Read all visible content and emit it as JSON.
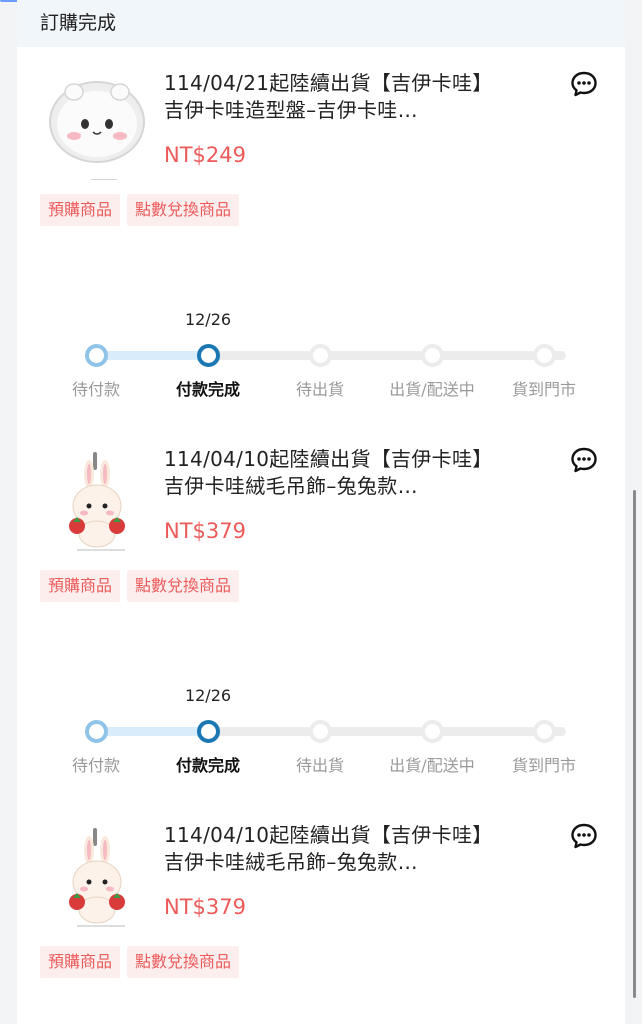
{
  "header": {
    "title": "訂購完成"
  },
  "colors": {
    "price": "#ec5a5a",
    "tag_bg": "#fdeeee",
    "progress_active": "#1b78b5",
    "progress_done": "#8fc3e8"
  },
  "orders": [
    {
      "title": "114/04/21起陸續出貨【吉伊卡哇】吉伊卡哇造型盤–吉伊卡哇…",
      "price": "NT$249",
      "image": "chiikawa-face-plate",
      "tags": [
        "預購商品",
        "點數兌換商品"
      ],
      "progress": {
        "date": "12/26",
        "steps": [
          "待付款",
          "付款完成",
          "待出貨",
          "出貨/配送中",
          "貨到門市"
        ],
        "current_step": 2
      }
    },
    {
      "title": "114/04/10起陸續出貨【吉伊卡哇】吉伊卡哇絨毛吊飾–兔兔款…",
      "price": "NT$379",
      "image": "usagi-plush-charm",
      "tags": [
        "預購商品",
        "點數兌換商品"
      ],
      "progress": {
        "date": "12/26",
        "steps": [
          "待付款",
          "付款完成",
          "待出貨",
          "出貨/配送中",
          "貨到門市"
        ],
        "current_step": 2
      }
    },
    {
      "title": "114/04/10起陸續出貨【吉伊卡哇】吉伊卡哇絨毛吊飾–兔兔款…",
      "price": "NT$379",
      "image": "usagi-plush-charm",
      "tags": [
        "預購商品",
        "點數兌換商品"
      ]
    }
  ]
}
